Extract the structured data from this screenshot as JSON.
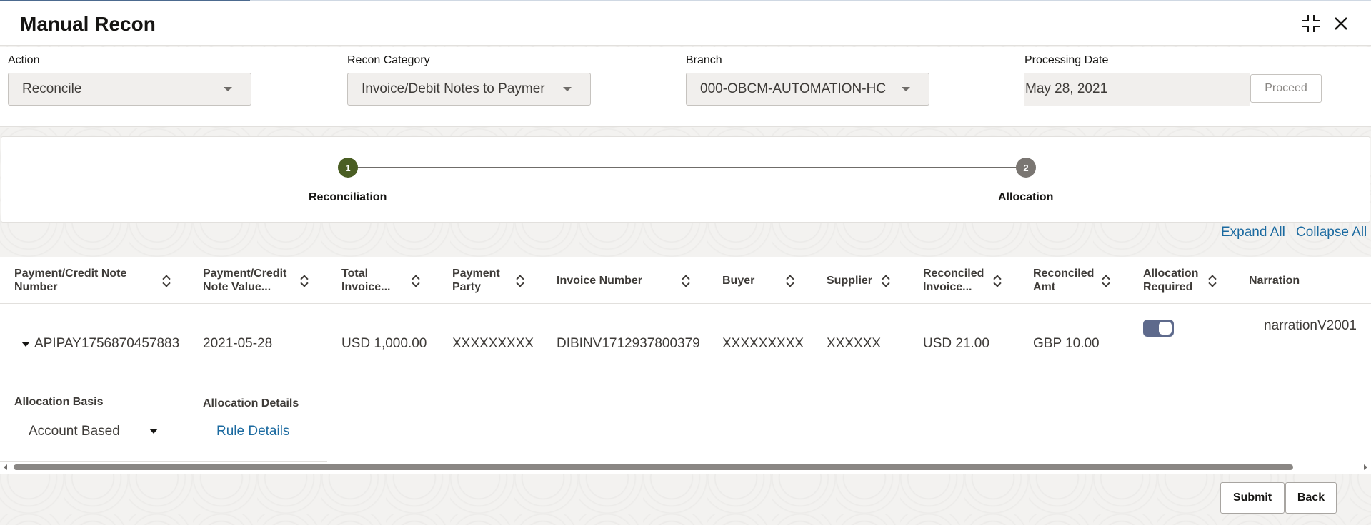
{
  "window": {
    "title": "Manual Recon"
  },
  "filters": {
    "action": {
      "label": "Action",
      "value": "Reconcile"
    },
    "recon_category": {
      "label": "Recon Category",
      "value": "Invoice/Debit Notes to Paymer"
    },
    "branch": {
      "label": "Branch",
      "value": "000-OBCM-AUTOMATION-HC"
    },
    "processing_date": {
      "label": "Processing Date",
      "value": "May 28, 2021"
    },
    "proceed_label": "Proceed"
  },
  "stepper": {
    "steps": [
      {
        "number": "1",
        "label": "Reconciliation",
        "state": "active"
      },
      {
        "number": "2",
        "label": "Allocation",
        "state": "pending"
      }
    ]
  },
  "grid": {
    "expand_all": "Expand All",
    "collapse_all": "Collapse All",
    "columns": [
      {
        "line1": "Payment/Credit Note",
        "line2": "Number"
      },
      {
        "line1": "Payment/Credit",
        "line2": "Note Value..."
      },
      {
        "line1": "Total",
        "line2": "Invoice..."
      },
      {
        "line1": "Payment",
        "line2": "Party"
      },
      {
        "line1": "Invoice Number",
        "line2": ""
      },
      {
        "line1": "Buyer",
        "line2": ""
      },
      {
        "line1": "Supplier",
        "line2": ""
      },
      {
        "line1": "Reconciled",
        "line2": "Invoice..."
      },
      {
        "line1": "Reconciled",
        "line2": "Amt"
      },
      {
        "line1": "Allocation",
        "line2": "Required"
      },
      {
        "line1": "Narration",
        "line2": ""
      }
    ],
    "rows": [
      {
        "payment_number": "APIPAY1756870457883",
        "payment_value_date": "2021-05-28",
        "total_invoice": "USD 1,000.00",
        "payment_party": "XXXXXXXXX",
        "invoice_number": "DIBINV1712937800379",
        "buyer": "XXXXXXXXX",
        "supplier": "XXXXXX",
        "reconciled_invoice": "USD 21.00",
        "reconciled_amt": "GBP 10.00",
        "allocation_required": true,
        "narration": "narrationV2001"
      }
    ],
    "detail": {
      "allocation_basis_label": "Allocation Basis",
      "allocation_basis_value": "Account Based",
      "allocation_details_label": "Allocation Details",
      "rule_details_link": "Rule Details"
    }
  },
  "footer": {
    "submit_label": "Submit",
    "back_label": "Back"
  },
  "colors": {
    "accent_link": "#1b6aa0",
    "step_active": "#4a5e23",
    "step_pending": "#7a7672",
    "toggle_on": "#5e6a8c"
  }
}
